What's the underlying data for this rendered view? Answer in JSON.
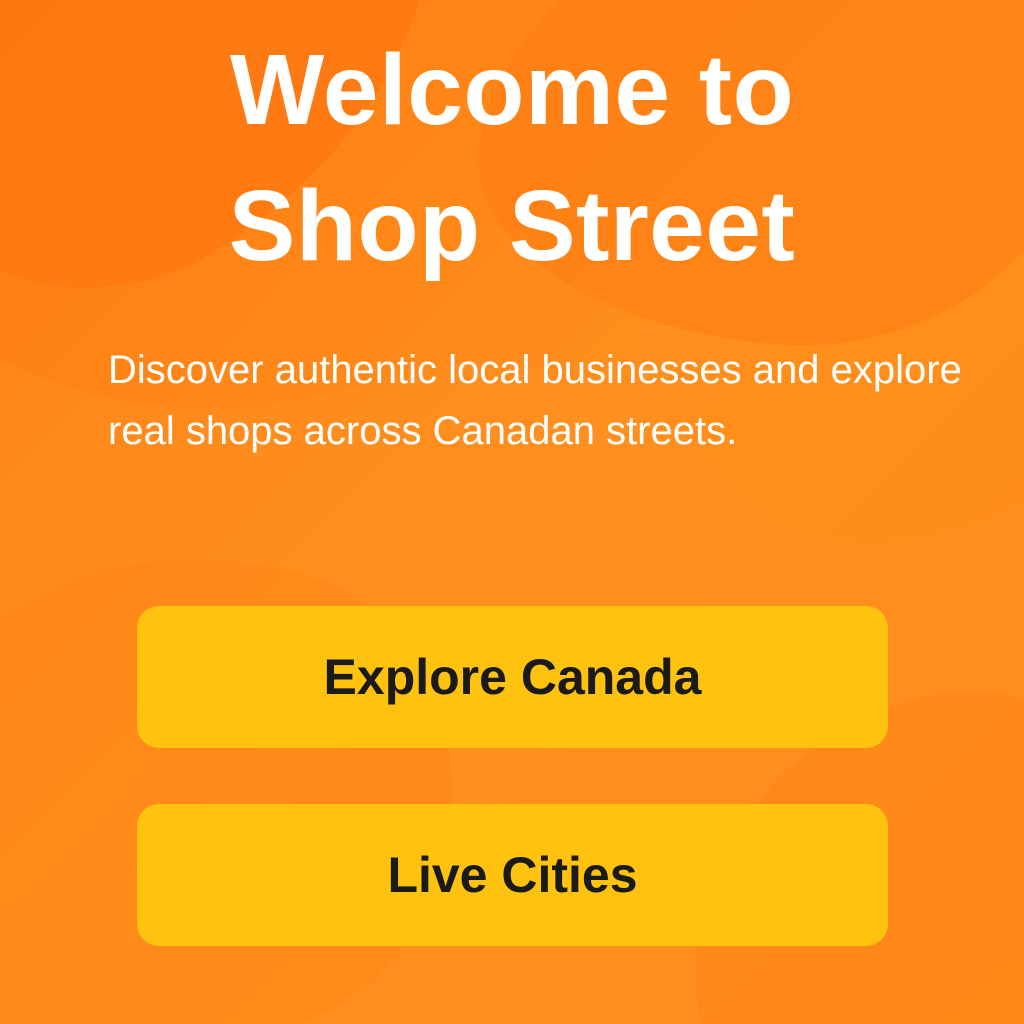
{
  "hero": {
    "title_line1": "Welcome to",
    "title_line2": "Shop Street",
    "subtitle": "Discover authentic local businesses and explore real shops across Canadan streets."
  },
  "actions": {
    "explore_label": "Explore Canada",
    "live_label": "Live Cities"
  },
  "colors": {
    "background": "#ff8a1a",
    "button": "#ffc20e",
    "button_text": "#1a1a1a",
    "heading_text": "#ffffff"
  }
}
